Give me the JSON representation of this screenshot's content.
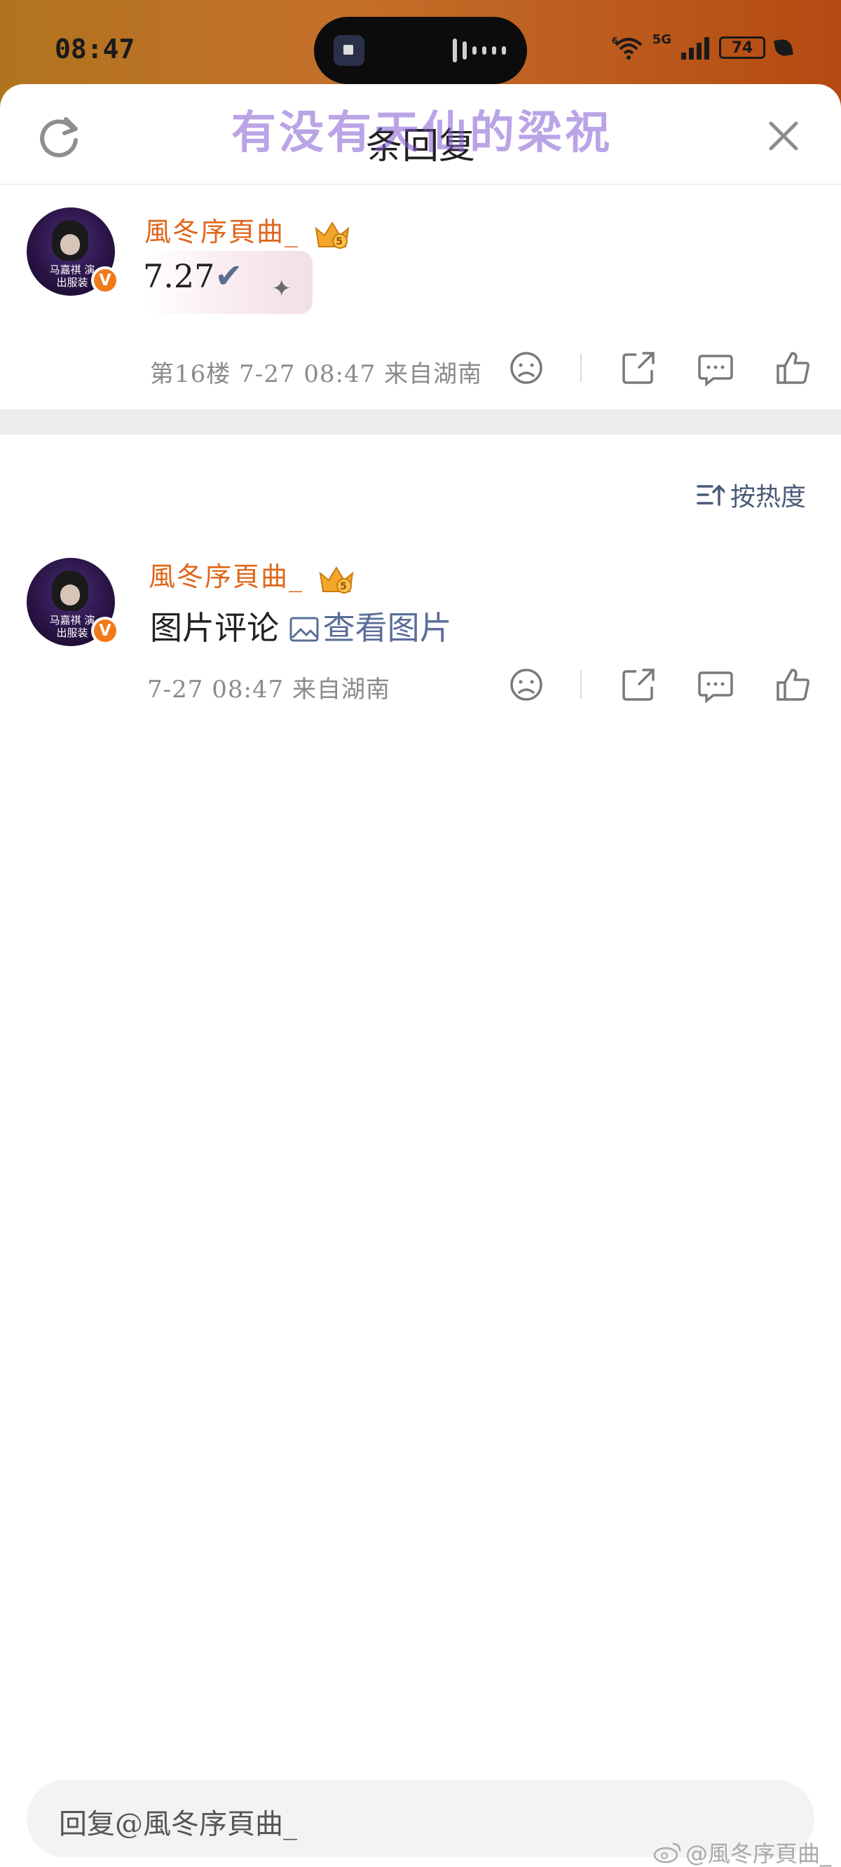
{
  "status_bar": {
    "time": "08:47",
    "network_small": "6",
    "network_label": "5G",
    "battery": "74"
  },
  "header": {
    "title": "条回复",
    "watermark": "有没有天仙的梁祝"
  },
  "main_comment": {
    "username": "風冬序頁曲_",
    "crown_level": "5",
    "text": "7.27",
    "check": "✔",
    "floor": "第16楼",
    "time": "7-27 08:47",
    "location": "来自湖南"
  },
  "sort_label": "按热度",
  "reply_comment": {
    "username": "風冬序頁曲_",
    "crown_level": "5",
    "text": "图片评论",
    "view_image": "查看图片",
    "time": "7-27 08:47",
    "location": "来自湖南"
  },
  "avatar_caption": "马嘉祺 演出服装",
  "reply_input": {
    "placeholder": "回复@風冬序頁曲_"
  },
  "weibo_watermark": "@風冬序頁曲_",
  "colors": {
    "username": "#e0661a",
    "link": "#5a6e98",
    "verified_badge": "#f07a1a"
  }
}
